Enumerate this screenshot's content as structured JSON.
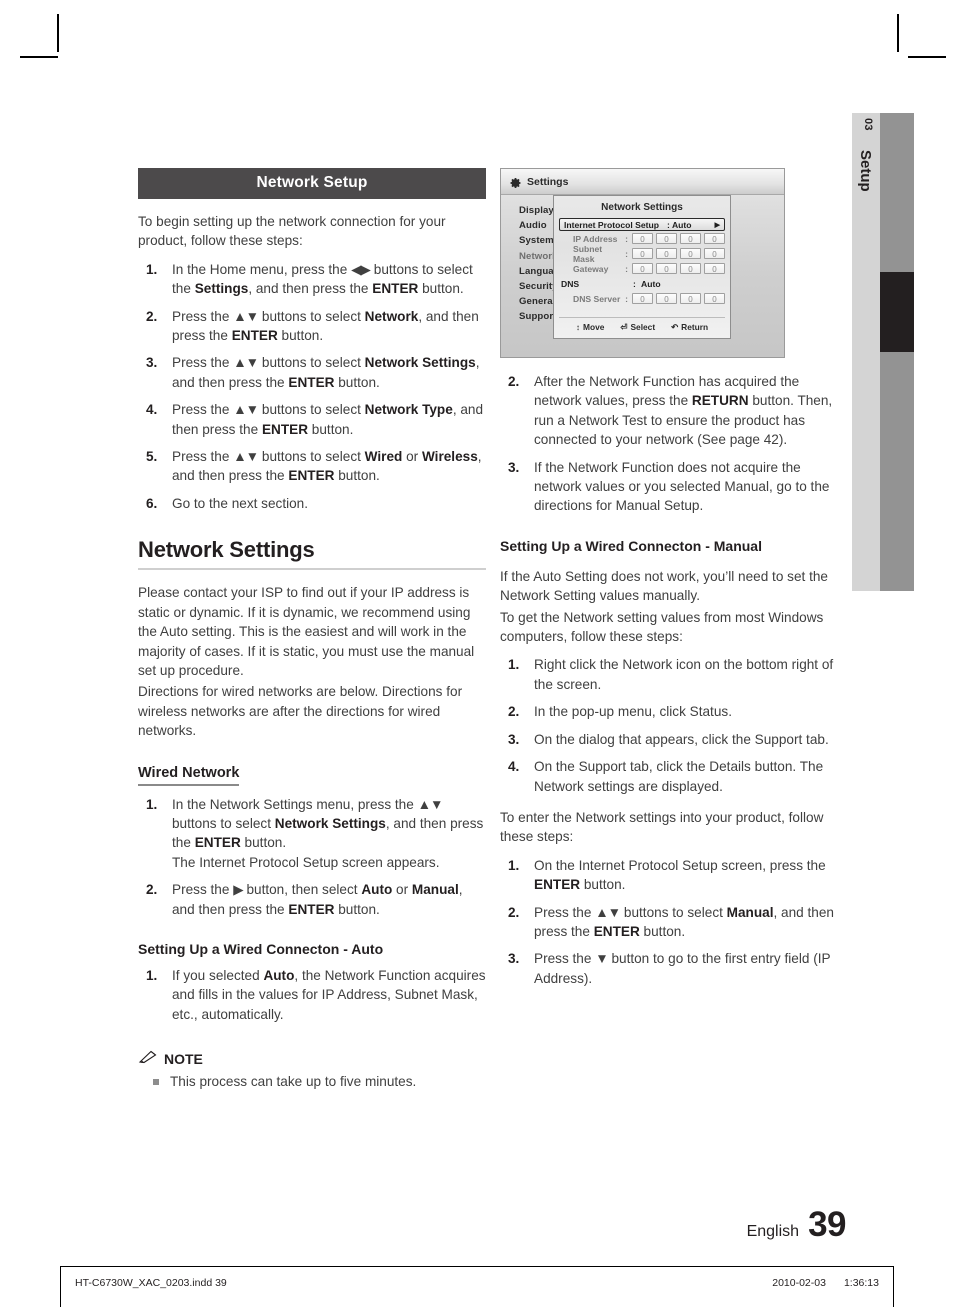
{
  "side_tab": {
    "chapter_number": "03",
    "chapter_label": "Setup"
  },
  "left_column": {
    "section_bar_title": "Network Setup",
    "intro": "To begin setting up the network connection for your product, follow these steps:",
    "steps": [
      {
        "num": "1.",
        "html": "In the Home menu, press the <span class=\"arrows\">◀▶</span> buttons to select the <b>Settings</b>, and then press the <b>ENTER</b> button."
      },
      {
        "num": "2.",
        "html": "Press the <span class=\"arrows\">▲▼</span> buttons to select <b>Network</b>, and then press the <b>ENTER</b> button."
      },
      {
        "num": "3.",
        "html": "Press the <span class=\"arrows\">▲▼</span> buttons to select <b>Network Settings</b>, and then press the <b>ENTER</b> button."
      },
      {
        "num": "4.",
        "html": "Press the <span class=\"arrows\">▲▼</span> buttons to select <b>Network Type</b>, and then press the <b>ENTER</b> button."
      },
      {
        "num": "5.",
        "html": "Press the <span class=\"arrows\">▲▼</span> buttons to select <b>Wired</b> or <b>Wireless</b>, and then press the <b>ENTER</b> button."
      },
      {
        "num": "6.",
        "html": "Go to the next section."
      }
    ],
    "network_settings_heading": "Network Settings",
    "network_settings_para1": "Please contact your ISP to find out if your IP address is static or dynamic. If it is dynamic, we recommend using the Auto setting. This is the easiest and will work in the majority of cases. If it is static, you must use the manual set up procedure.",
    "network_settings_para2": "Directions for wired networks are below. Directions for wireless networks are after the directions for wired networks.",
    "wired_network_heading": "Wired Network",
    "wired_steps": [
      {
        "num": "1.",
        "html": "In the Network Settings menu, press the <span class=\"arrows\">▲▼</span> buttons to select <b>Network Settings</b>, and then press the <b>ENTER</b> button.<br>The Internet Protocol Setup screen appears."
      },
      {
        "num": "2.",
        "html": "Press the <span class=\"arrows\">▶</span> button, then select <b>Auto</b> or <b>Manual</b>, and then press the <b>ENTER</b> button."
      }
    ],
    "auto_heading": "Setting Up a Wired Connecton - Auto",
    "auto_steps": [
      {
        "num": "1.",
        "html": "If you selected <b>Auto</b>, the Network Function acquires and fills in the values for IP Address, Subnet Mask, etc., automatically."
      }
    ],
    "note_label": "NOTE",
    "note_items": [
      "This process can take up to five minutes."
    ]
  },
  "tv_screenshot": {
    "titlebar": "Settings",
    "menu_items": [
      {
        "label": "Display",
        "dimmed": false
      },
      {
        "label": "Audio",
        "dimmed": false
      },
      {
        "label": "System",
        "dimmed": false
      },
      {
        "label": "Network",
        "dimmed": true
      },
      {
        "label": "Language",
        "dimmed": false
      },
      {
        "label": "Security",
        "dimmed": false
      },
      {
        "label": "General",
        "dimmed": false
      },
      {
        "label": "Support",
        "dimmed": false
      }
    ],
    "dialog_title": "Network Settings",
    "highlight_row": {
      "label": "Internet Protocol Setup",
      "separator": ":",
      "value": "Auto",
      "arrow": "▶"
    },
    "field_rows": [
      {
        "label": "IP Address",
        "colon": ":",
        "octets": [
          "0",
          "0",
          "0",
          "0"
        ]
      },
      {
        "label": "Subnet Mask",
        "colon": ":",
        "octets": [
          "0",
          "0",
          "0",
          "0"
        ]
      },
      {
        "label": "Gateway",
        "colon": ":",
        "octets": [
          "0",
          "0",
          "0",
          "0"
        ]
      }
    ],
    "dns_row": {
      "label": "DNS",
      "colon": ":",
      "value": "Auto"
    },
    "dns_server_row": {
      "label": "DNS Server",
      "colon": ":",
      "octets": [
        "0",
        "0",
        "0",
        "0"
      ]
    },
    "footer_hints": [
      {
        "icon": "↕",
        "label": "Move"
      },
      {
        "icon": "⏎",
        "label": "Select"
      },
      {
        "icon": "↶",
        "label": "Return"
      }
    ]
  },
  "right_column": {
    "auto_steps": [
      {
        "num": "2.",
        "html": "After the Network Function has acquired the network values, press the <b>RETURN</b> button. Then, run a Network Test to ensure the product has connected to your network (See page 42)."
      },
      {
        "num": "3.",
        "html": "If the Network Function does not acquire the network values or you selected Manual, go to the directions for Manual Setup."
      }
    ],
    "manual_heading": "Setting Up a Wired Connecton - Manual",
    "manual_para1": "If the Auto Setting does not work, you’ll need to set the Network Setting values manually.",
    "manual_para2": "To get the Network setting values from most Windows computers, follow these steps:",
    "windows_steps": [
      {
        "num": "1.",
        "html": "Right click the Network icon on the bottom right of the screen."
      },
      {
        "num": "2.",
        "html": "In the pop-up menu, click Status."
      },
      {
        "num": "3.",
        "html": "On the dialog that appears, click the Support tab."
      },
      {
        "num": "4.",
        "html": "On the Support tab, click the Details button. The Network settings are displayed."
      }
    ],
    "enter_para": "To enter the Network settings into your product, follow these steps:",
    "enter_steps": [
      {
        "num": "1.",
        "html": "On the Internet Protocol Setup screen, press the <b>ENTER</b> button."
      },
      {
        "num": "2.",
        "html": "Press the <span class=\"arrows\">▲▼</span> buttons to select <b>Manual</b>, and then press the <b>ENTER</b> button."
      },
      {
        "num": "3.",
        "html": "Press the <span class=\"arrows\">▼</span> button to go to the first entry field (IP Address)."
      }
    ]
  },
  "page_footer": {
    "language": "English",
    "page_number": "39",
    "file_name": "HT-C6730W_XAC_0203.indd   39",
    "date": "2010-02-03",
    "time": "1:36:13"
  },
  "colors": {
    "section_bar_bg": "#4c4a4b",
    "body_text": "#404040",
    "heading_text": "#231f20",
    "side_tab_light": "#d4d4d4",
    "side_tab_gray": "#939393",
    "side_tab_marker": "#231f20"
  }
}
